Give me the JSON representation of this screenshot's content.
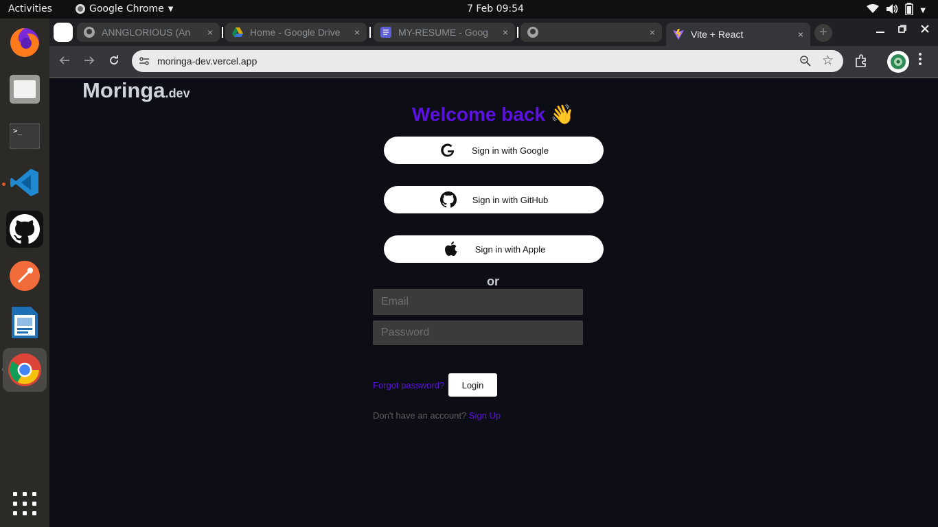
{
  "system": {
    "activities": "Activities",
    "app_menu": "Google Chrome",
    "clock": "7 Feb  09:54"
  },
  "dock": {
    "items": [
      "firefox-icon",
      "files-icon",
      "terminal-icon",
      "vscode-icon",
      "github-desktop-icon",
      "postman-icon",
      "libreoffice-impress-icon",
      "chrome-icon"
    ],
    "app_grid": "show-apps-icon"
  },
  "browser": {
    "tabs": [
      {
        "title": "ANNGLORIOUS (An",
        "icon": "github-icon",
        "close": "×"
      },
      {
        "title": "Home - Google Drive",
        "icon": "google-drive-icon",
        "close": "×"
      },
      {
        "title": "MY-RESUME - Goog",
        "icon": "google-docs-icon",
        "close": "×"
      },
      {
        "title": "",
        "icon": "github-icon",
        "close": "×"
      },
      {
        "title": "Vite + React",
        "icon": "vite-icon",
        "close": "×"
      }
    ],
    "new_tab": "+",
    "url": "moringa-dev.vercel.app"
  },
  "page": {
    "brand": "Moringa",
    "brand_suffix": ".dev",
    "welcome": "Welcome back",
    "welcome_emoji": "👋",
    "google_button": "Sign in with Google",
    "github_button": "Sign in with GitHub",
    "apple_button": "Sign in with Apple",
    "or": "or",
    "email_placeholder": "Email",
    "password_placeholder": "Password",
    "forgot": "Forgot password?",
    "login": "Login",
    "no_account": "Don't have an account?",
    "signup": "Sign Up"
  },
  "colors": {
    "accent": "#5b12e0",
    "page_bg": "#0d0e15",
    "field_bg": "#3b3b3b"
  }
}
